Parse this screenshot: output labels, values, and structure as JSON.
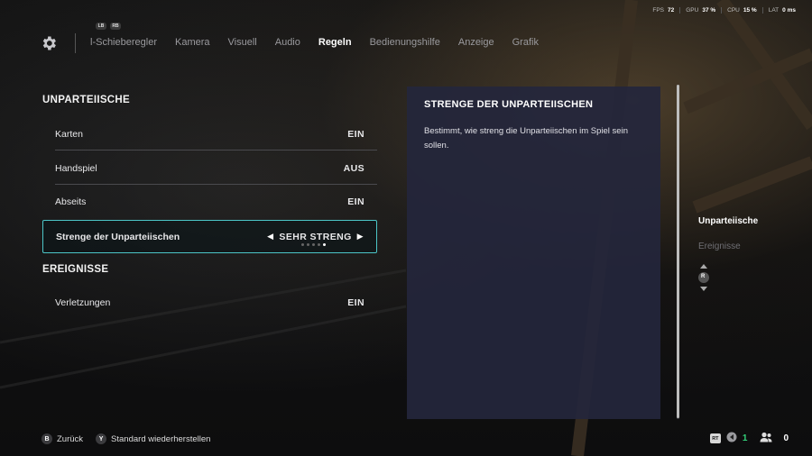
{
  "hud": {
    "fps_label": "FPS",
    "fps_value": "72",
    "gpu_label": "GPU",
    "gpu_value": "37 %",
    "cpu_label": "CPU",
    "cpu_value": "15 %",
    "lat_label": "LAT",
    "lat_value": "0 ms"
  },
  "nav": {
    "bumper_left": "LB",
    "bumper_right": "RB",
    "tabs": [
      {
        "label": "l-Schieberegler",
        "active": false
      },
      {
        "label": "Kamera",
        "active": false
      },
      {
        "label": "Visuell",
        "active": false
      },
      {
        "label": "Audio",
        "active": false
      },
      {
        "label": "Regeln",
        "active": true
      },
      {
        "label": "Bedienungshilfe",
        "active": false
      },
      {
        "label": "Anzeige",
        "active": false
      },
      {
        "label": "Grafik",
        "active": false
      }
    ]
  },
  "sections": {
    "referees": {
      "title": "UNPARTEIISCHE",
      "rows": [
        {
          "label": "Karten",
          "value": "EIN"
        },
        {
          "label": "Handspiel",
          "value": "AUS"
        },
        {
          "label": "Abseits",
          "value": "EIN"
        },
        {
          "label": "Strenge der Unparteiischen",
          "value": "SEHR STRENG",
          "selected": true,
          "steps": 5,
          "current_step": 5
        }
      ]
    },
    "events": {
      "title": "EREIGNISSE",
      "rows": [
        {
          "label": "Verletzungen",
          "value": "EIN"
        }
      ]
    }
  },
  "description": {
    "title": "STRENGE DER UNPARTEIISCHEN",
    "text": "Bestimmt, wie streng die Unparteiischen im Spiel sein sollen."
  },
  "jump_list": {
    "items": [
      {
        "label": "Unparteiische",
        "active": true
      },
      {
        "label": "Ereignisse",
        "active": false
      }
    ],
    "stick_label": "R"
  },
  "footer": {
    "back_key": "B",
    "back_label": "Zurück",
    "reset_key": "Y",
    "reset_label": "Standard wiederherstellen",
    "rt_key": "RT",
    "green_count": "1",
    "party_count": "0"
  },
  "colors": {
    "accent_selected": "#4cc6c8",
    "panel_bg": "#24263c",
    "online_green": "#33d17a"
  }
}
